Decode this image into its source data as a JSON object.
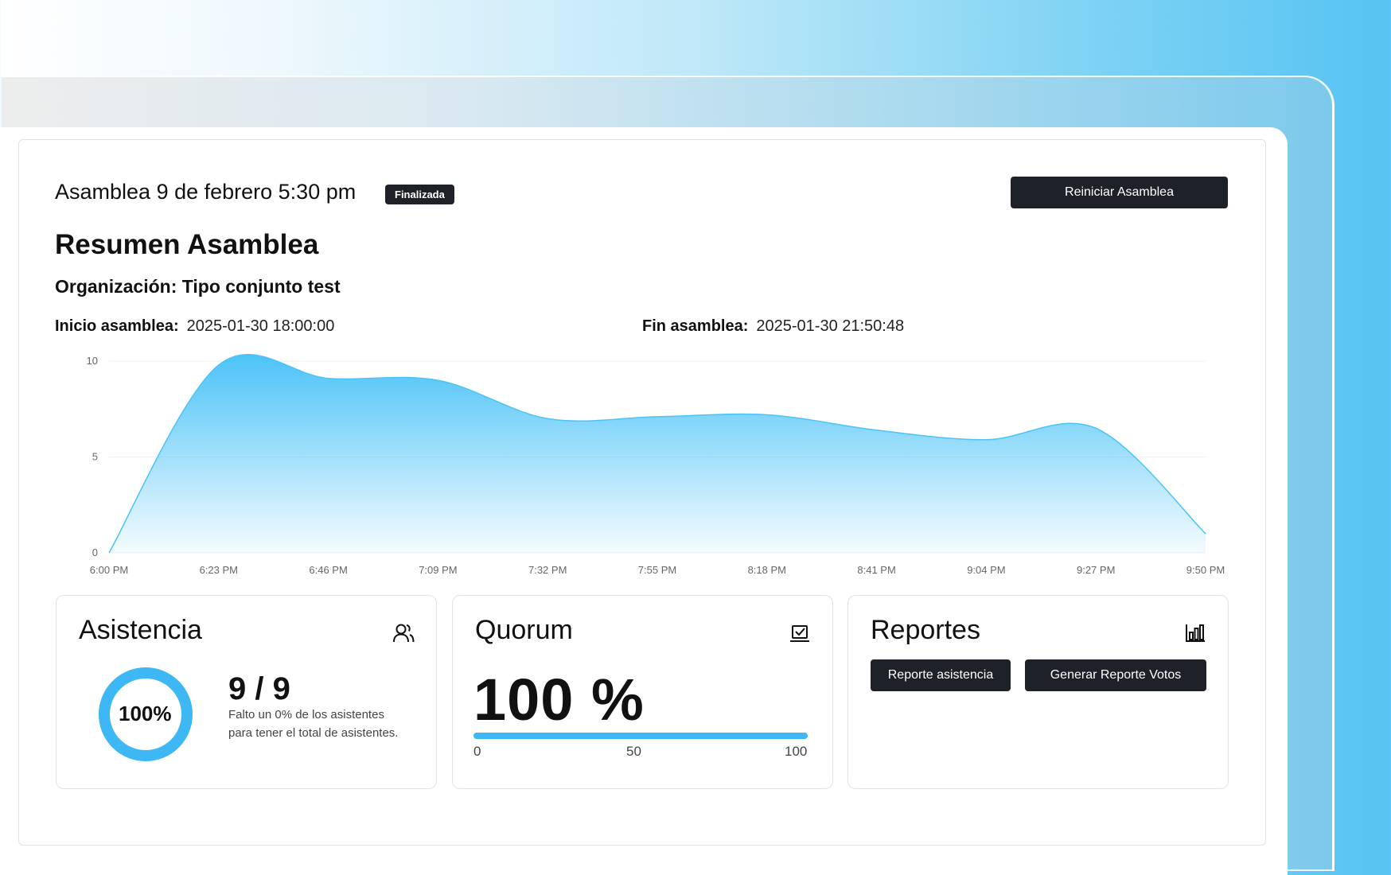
{
  "header": {
    "assembly_title": "Asamblea 9 de febrero 5:30 pm",
    "status_badge": "Finalizada",
    "restart_button": "Reiniciar Asamblea"
  },
  "summary": {
    "title": "Resumen Asamblea",
    "organization": "Organización: Tipo conjunto test",
    "start_label": "Inicio asamblea:",
    "start_value": "2025-01-30 18:00:00",
    "end_label": "Fin asamblea:",
    "end_value": "2025-01-30 21:50:48"
  },
  "chart_data": {
    "type": "area",
    "x": [
      "6:00 PM",
      "6:23 PM",
      "6:46 PM",
      "7:09 PM",
      "7:32 PM",
      "7:55 PM",
      "8:18 PM",
      "8:41 PM",
      "9:04 PM",
      "9:27 PM",
      "9:50 PM"
    ],
    "y": [
      0,
      9.8,
      9.1,
      9.0,
      7.0,
      7.1,
      7.2,
      6.4,
      5.9,
      6.5,
      1.0
    ],
    "yticks": [
      0,
      5,
      10
    ],
    "ylim": [
      0,
      10
    ],
    "grid": true,
    "color": "#4cc3f7"
  },
  "attendance": {
    "title": "Asistencia",
    "icon": "users-icon",
    "percent_label": "100%",
    "percent": 100,
    "count": "9 / 9",
    "note": "Falto un 0% de los asistentes para tener el total de asistentes.",
    "ring_color": "#3db8f5"
  },
  "quorum": {
    "title": "Quorum",
    "icon": "checklist-icon",
    "value_label": "100 %",
    "percent": 100,
    "tick_min": "0",
    "tick_mid": "50",
    "tick_max": "100"
  },
  "reports": {
    "title": "Reportes",
    "icon": "bar-chart-icon",
    "attendance_report_button": "Reporte asistencia",
    "votes_report_button": "Generar Reporte Votos"
  }
}
